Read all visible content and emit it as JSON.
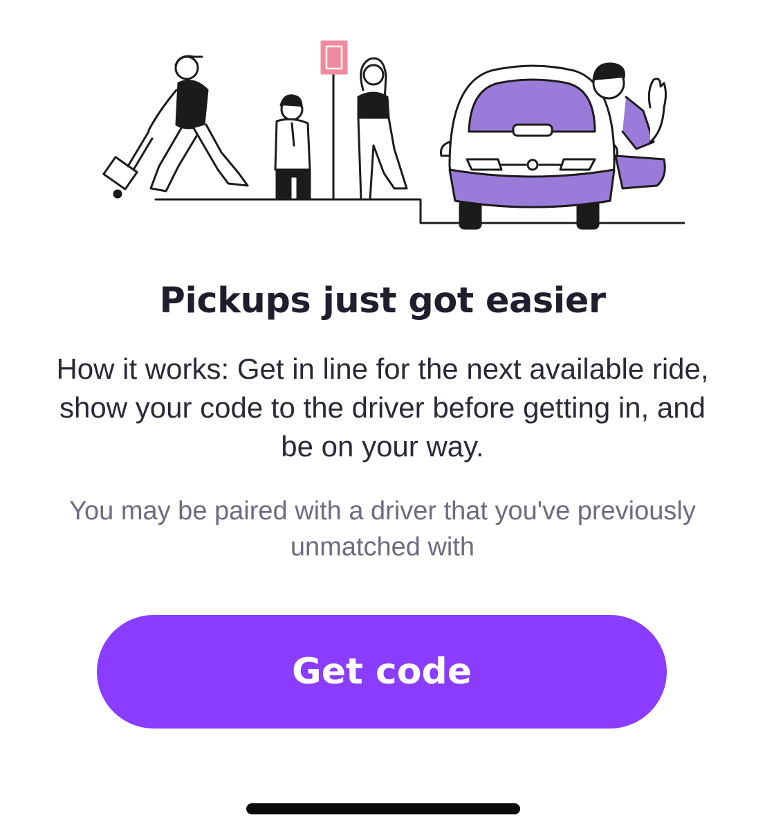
{
  "onboarding": {
    "title": "Pickups just got easier",
    "description": "How it works: Get in line for the next available ride, show your code to the driver before getting in, and be on your way.",
    "note": "You may be paired with a driver that you've previously unmatched with",
    "cta_label": "Get code"
  },
  "illustration": {
    "icon": "pickup-line-illustration"
  },
  "colors": {
    "accent": "#8a3cff",
    "car_purple": "#9b7bd9",
    "sign_pink": "#f08aa0",
    "title_text": "#1f1e2e",
    "note_text": "#6c6c80"
  }
}
